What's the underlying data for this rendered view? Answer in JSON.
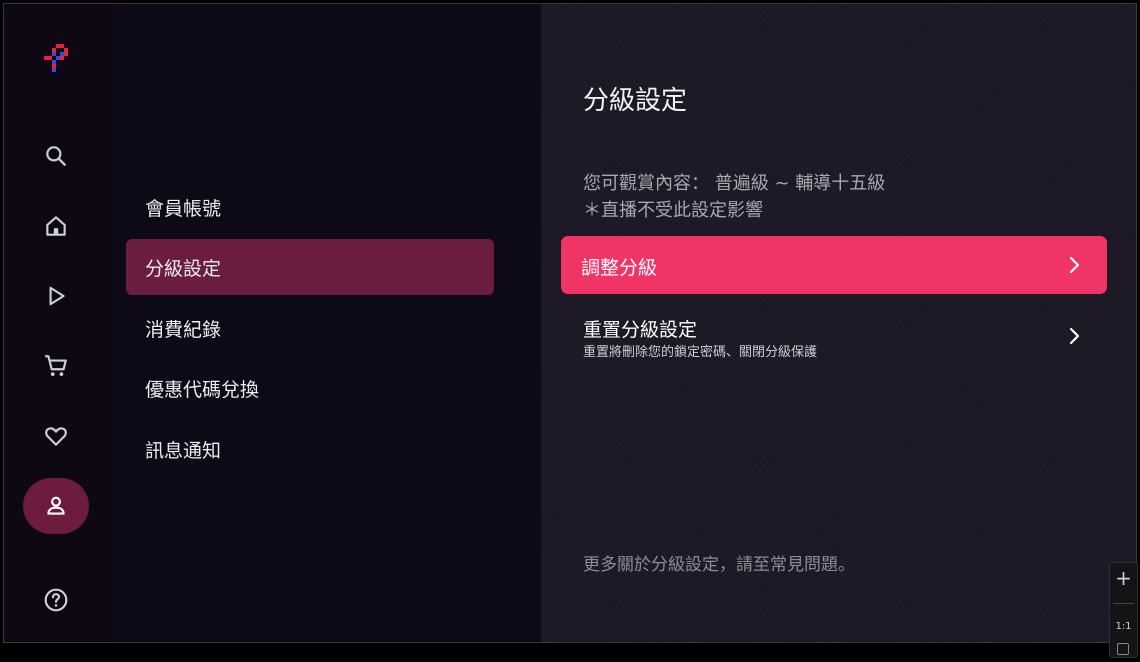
{
  "sidebar_nav": {
    "items": [
      {
        "name": "search",
        "icon": "search-icon"
      },
      {
        "name": "home",
        "icon": "home-icon"
      },
      {
        "name": "play",
        "icon": "play-icon"
      },
      {
        "name": "cart",
        "icon": "cart-icon"
      },
      {
        "name": "favorites",
        "icon": "heart-icon"
      },
      {
        "name": "account",
        "icon": "person-icon",
        "active": true
      },
      {
        "name": "help",
        "icon": "help-icon"
      }
    ]
  },
  "menu": {
    "items": [
      {
        "label": "會員帳號"
      },
      {
        "label": "分級設定",
        "active": true
      },
      {
        "label": "消費紀錄"
      },
      {
        "label": "優惠代碼兌換"
      },
      {
        "label": "訊息通知"
      }
    ]
  },
  "content": {
    "title": "分級設定",
    "viewable_text": "您可觀賞內容： 普遍級 ~ 輔導十五級",
    "live_note": "＊直播不受此設定影響",
    "options": [
      {
        "label": "調整分級",
        "active": true
      },
      {
        "label": "重置分級設定",
        "sublabel": "重置將刪除您的鎖定密碼、關閉分級保護"
      }
    ],
    "faq_note": "更多關於分級設定，請至常見問題。"
  },
  "zoom_control": {
    "plus": "+",
    "ratio": "1:1"
  },
  "colors": {
    "accent": "#f03466",
    "active_nav": "#6d1b3e",
    "active_menu": "#6a1d40",
    "background": "#0c0713",
    "content_bg": "#1b1623"
  }
}
